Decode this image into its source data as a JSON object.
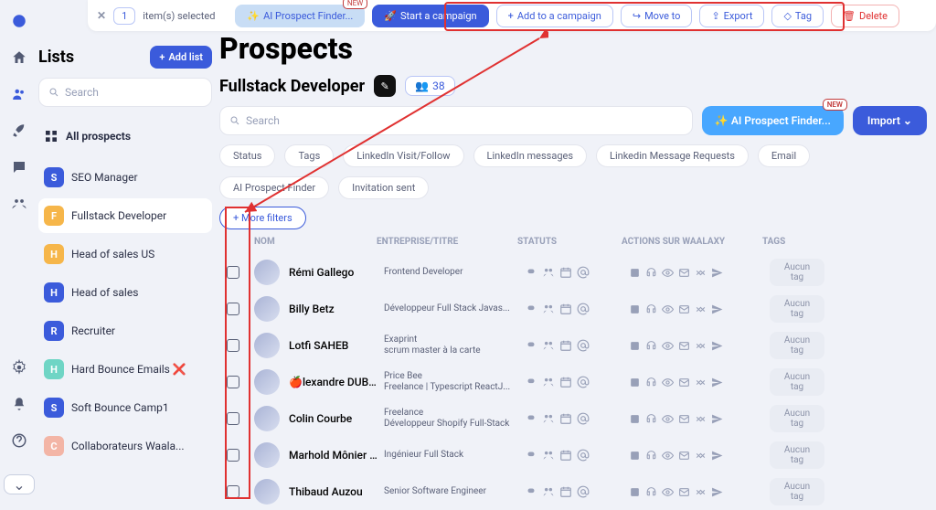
{
  "topbar": {
    "selected_count": "1",
    "selected_text": "item(s) selected",
    "ai_label": "AI Prospect Finder...",
    "new_label": "NEW",
    "start_campaign": "Start a campaign",
    "add_campaign": "Add to a campaign",
    "move_to": "Move to",
    "export": "Export",
    "tag": "Tag",
    "delete": "Delete"
  },
  "sidebar": {
    "title": "Lists",
    "add_list": "Add list",
    "search_placeholder": "Search",
    "all_prospects": "All prospects",
    "items": [
      {
        "letter": "S",
        "color": "#3b5bdb",
        "label": "SEO Manager"
      },
      {
        "letter": "F",
        "color": "#f6b64a",
        "label": "Fullstack Developer",
        "active": true
      },
      {
        "letter": "H",
        "color": "#f6b64a",
        "label": "Head of sales US"
      },
      {
        "letter": "H",
        "color": "#3b5bdb",
        "label": "Head of sales"
      },
      {
        "letter": "R",
        "color": "#3b5bdb",
        "label": "Recruiter"
      },
      {
        "letter": "H",
        "color": "#6fd5c5",
        "label": "Hard Bounce Emails ❌"
      },
      {
        "letter": "S",
        "color": "#3b5bdb",
        "label": "Soft Bounce Camp1"
      },
      {
        "letter": "C",
        "color": "#f3b5a6",
        "label": "Collaborateurs Waala..."
      }
    ]
  },
  "page": {
    "title": "Prospects",
    "subtitle": "Fullstack Developer",
    "count": "38",
    "search_placeholder": "Search",
    "ai_finder": "AI Prospect Finder...",
    "new_label": "NEW",
    "import": "Import"
  },
  "filters": {
    "chips": [
      "Status",
      "Tags",
      "LinkedIn Visit/Follow",
      "LinkedIn messages",
      "Linkedin Message Requests",
      "Email",
      "AI Prospect Finder",
      "Invitation sent"
    ],
    "more": "More filters"
  },
  "table": {
    "headers": {
      "nom": "NOM",
      "entreprise": "ENTREPRISE/TITRE",
      "statuts": "STATUTS",
      "actions": "ACTIONS SUR WAALAXY",
      "tags": "TAGS"
    },
    "tag_placeholder": "Aucun tag",
    "rows": [
      {
        "name": "Rémi Gallego",
        "title": "Frontend Developer"
      },
      {
        "name": "Billy Betz",
        "title": "Développeur Full Stack Javas..."
      },
      {
        "name": "Lotfi SAHEB",
        "title": "Exaprint\nscrum master à la carte"
      },
      {
        "name": "🍎lexandre DUBAR",
        "title": "Price Bee\nFreelance | Typescript ReactJ..."
      },
      {
        "name": "Colin Courbe",
        "title": "Freelance\nDéveloppeur Shopify Full-Stack"
      },
      {
        "name": "Marhold Mônier ✋",
        "title": "Ingénieur Full Stack"
      },
      {
        "name": "Thibaud Auzou",
        "title": "Senior Software Engineer"
      }
    ]
  }
}
